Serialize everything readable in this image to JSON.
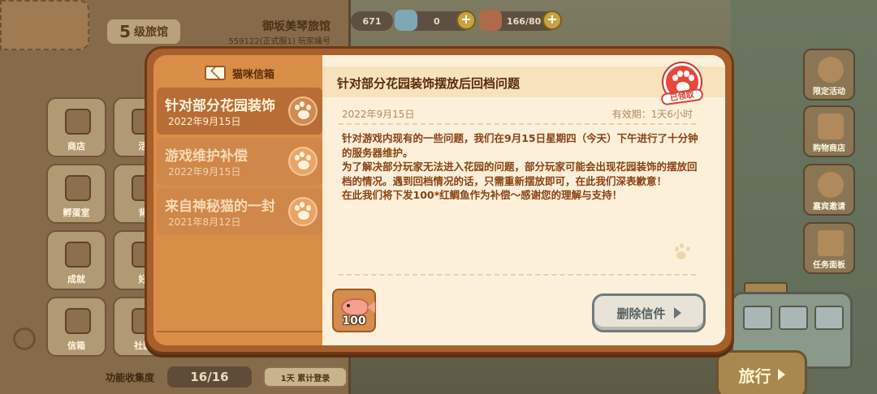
{
  "inn": {
    "level_num": "5",
    "level_label": "级旅馆",
    "name": "御坂美琴旅馆",
    "id": "559122(正式服1)",
    "id_label": "玩家编号",
    "grid": [
      {
        "label": "商店"
      },
      {
        "label": "活"
      },
      {
        "label": "孵蛋室"
      },
      {
        "label": "背"
      },
      {
        "label": "成就"
      },
      {
        "label": "好"
      },
      {
        "label": "信箱"
      },
      {
        "label": "社区"
      }
    ],
    "collect_label": "功能收集度",
    "collect_value": "16/16",
    "login_label": "1天 累计登录"
  },
  "currency": [
    {
      "value": "671",
      "icon": "coin-icon"
    },
    {
      "value": "0",
      "icon": "fish-icon"
    },
    {
      "value": "166/80",
      "icon": "ticket-icon"
    }
  ],
  "side_buttons": [
    {
      "label": "限定活动",
      "icon": "balloon-icon"
    },
    {
      "label": "购物商店",
      "icon": "shop-icon"
    },
    {
      "label": "嘉宾邀请",
      "icon": "cat-face-icon"
    },
    {
      "label": "任务面板",
      "icon": "board-icon"
    }
  ],
  "travel_label": "旅行",
  "mailbox": {
    "title": "猫咪信箱",
    "items": [
      {
        "title": "针对部分花园装饰",
        "date": "2022年9月15日",
        "active": true
      },
      {
        "title": "游戏维护补偿",
        "date": "2022年9月15日",
        "active": false
      },
      {
        "title": "来自神秘猫的一封",
        "date": "2021年8月12日",
        "active": false
      }
    ]
  },
  "mail": {
    "title": "针对部分花园装饰摆放后回档问题",
    "stamp": "已领取",
    "date": "2022年9月15日",
    "validity": "有效期：1天6小时",
    "body": [
      "针对游戏内现有的一些问题，我们在9月15日星期四（今天）下午进行了十分钟的服务器维护。",
      "为了解决部分玩家无法进入花园的问题，部分玩家可能会出现花园装饰的摆放回档的情况。遇到回档情况的话，只需重新摆放即可，在此我们深表歉意！",
      "在此我们将下发100*红鲷鱼作为补偿～感谢您的理解与支持！"
    ],
    "reward_count": "100",
    "reward_icon": "red-snapper-fish-icon",
    "delete_label": "删除信件"
  },
  "colors": {
    "modal_border": "#a95f2c",
    "sidebar": "#d98e47",
    "content_bg": "#fdf0da",
    "title_text": "#5a2a08",
    "stamp_red": "#e8473a"
  }
}
